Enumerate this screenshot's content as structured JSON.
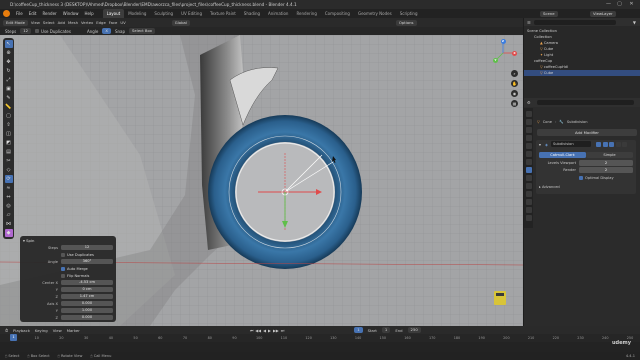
{
  "window": {
    "title": "D:\\coffeeCup_thickness 3 (DESKTOP)\\Ahmed\\Dropbox\\Blender\\EMD\\aworzca_files\\project_files\\coffeeCup_thickness.blend - Blender 4.4.1",
    "controls": [
      "—",
      "▢",
      "✕"
    ]
  },
  "menubar": {
    "menus": [
      "File",
      "Edit",
      "Render",
      "Window",
      "Help"
    ],
    "workspaces": [
      "Layout",
      "Modeling",
      "Sculpting",
      "UV Editing",
      "Texture Paint",
      "Shading",
      "Animation",
      "Rendering",
      "Compositing",
      "Geometry Nodes",
      "Scripting"
    ],
    "active_workspace": "Layout",
    "scene": "Scene",
    "view_layer": "ViewLayer"
  },
  "viewport_header": {
    "mode": "Edit Mode",
    "menus": [
      "View",
      "Select",
      "Add",
      "Mesh",
      "Vertex",
      "Edge",
      "Face",
      "UV"
    ],
    "orientation": "Global",
    "options": "Options"
  },
  "viewport_subheader": {
    "steps_label": "Steps",
    "steps_value": "12",
    "use_duplicates": "Use Duplicates",
    "angle_field": "Angle",
    "snap": "Snap",
    "snap_target": "Select Box"
  },
  "operator_panel": {
    "title": "Spin",
    "fields": [
      {
        "label": "Steps",
        "value": "12"
      },
      {
        "label": "",
        "value": "Use Duplicates"
      },
      {
        "label": "Angle",
        "value": "360°"
      },
      {
        "label": "",
        "value": "Auto Merge"
      },
      {
        "label": "",
        "value": "Flip Normals"
      },
      {
        "label": "Center X",
        "value": "-4.53 cm"
      },
      {
        "label": "Y",
        "value": "0 cm"
      },
      {
        "label": "Z",
        "value": "1.47 cm"
      },
      {
        "label": "Axis X",
        "value": "0.000"
      },
      {
        "label": "Y",
        "value": "1.000"
      },
      {
        "label": "Z",
        "value": "0.000"
      }
    ]
  },
  "gizmo": {
    "x": "X",
    "y": "Y",
    "z": "Z"
  },
  "outliner": {
    "search_placeholder": "",
    "items": [
      {
        "label": "Scene Collection",
        "depth": 0
      },
      {
        "label": "Collection",
        "depth": 1
      },
      {
        "label": "Camera",
        "depth": 2
      },
      {
        "label": "Cube",
        "depth": 2
      },
      {
        "label": "Light",
        "depth": 2
      },
      {
        "label": "coffeeCup",
        "depth": 1
      },
      {
        "label": "coffeeCupHdl",
        "depth": 2
      },
      {
        "label": "Cube",
        "depth": 2
      }
    ]
  },
  "properties": {
    "breadcrumb_object": "Cone",
    "breadcrumb_mod": "Subdivision",
    "add_modifier": "Add Modifier",
    "modifier_name": "Subdivision",
    "tab_catmull": "Catmull-Clark",
    "tab_simple": "Simple",
    "levels_viewport_label": "Levels Viewport",
    "levels_viewport_value": "2",
    "render_label": "Render",
    "render_value": "2",
    "optimal_display": "Optimal Display",
    "advanced": "Advanced"
  },
  "timeline": {
    "menus": [
      "Playback",
      "Keying",
      "View",
      "Marker"
    ],
    "current_frame": "1",
    "start_label": "Start",
    "start_value": "1",
    "end_label": "End",
    "end_value": "250",
    "ticks": [
      "0",
      "10",
      "20",
      "30",
      "40",
      "50",
      "60",
      "70",
      "80",
      "90",
      "100",
      "110",
      "120",
      "130",
      "140",
      "150",
      "160",
      "170",
      "180",
      "190",
      "200",
      "210",
      "220",
      "230",
      "240",
      "250"
    ]
  },
  "statusbar": {
    "items": [
      "Select",
      "Box Select",
      "Rotate View",
      "Call Menu"
    ],
    "version": "4.4.1"
  },
  "watermark": "udemy",
  "colors": {
    "accent": "#4772b3",
    "selection": "#334d80",
    "active_workspace": "#3d3d3d",
    "mesh_blue": "#2c5f8a",
    "orange_logo": "#e87d0d"
  }
}
